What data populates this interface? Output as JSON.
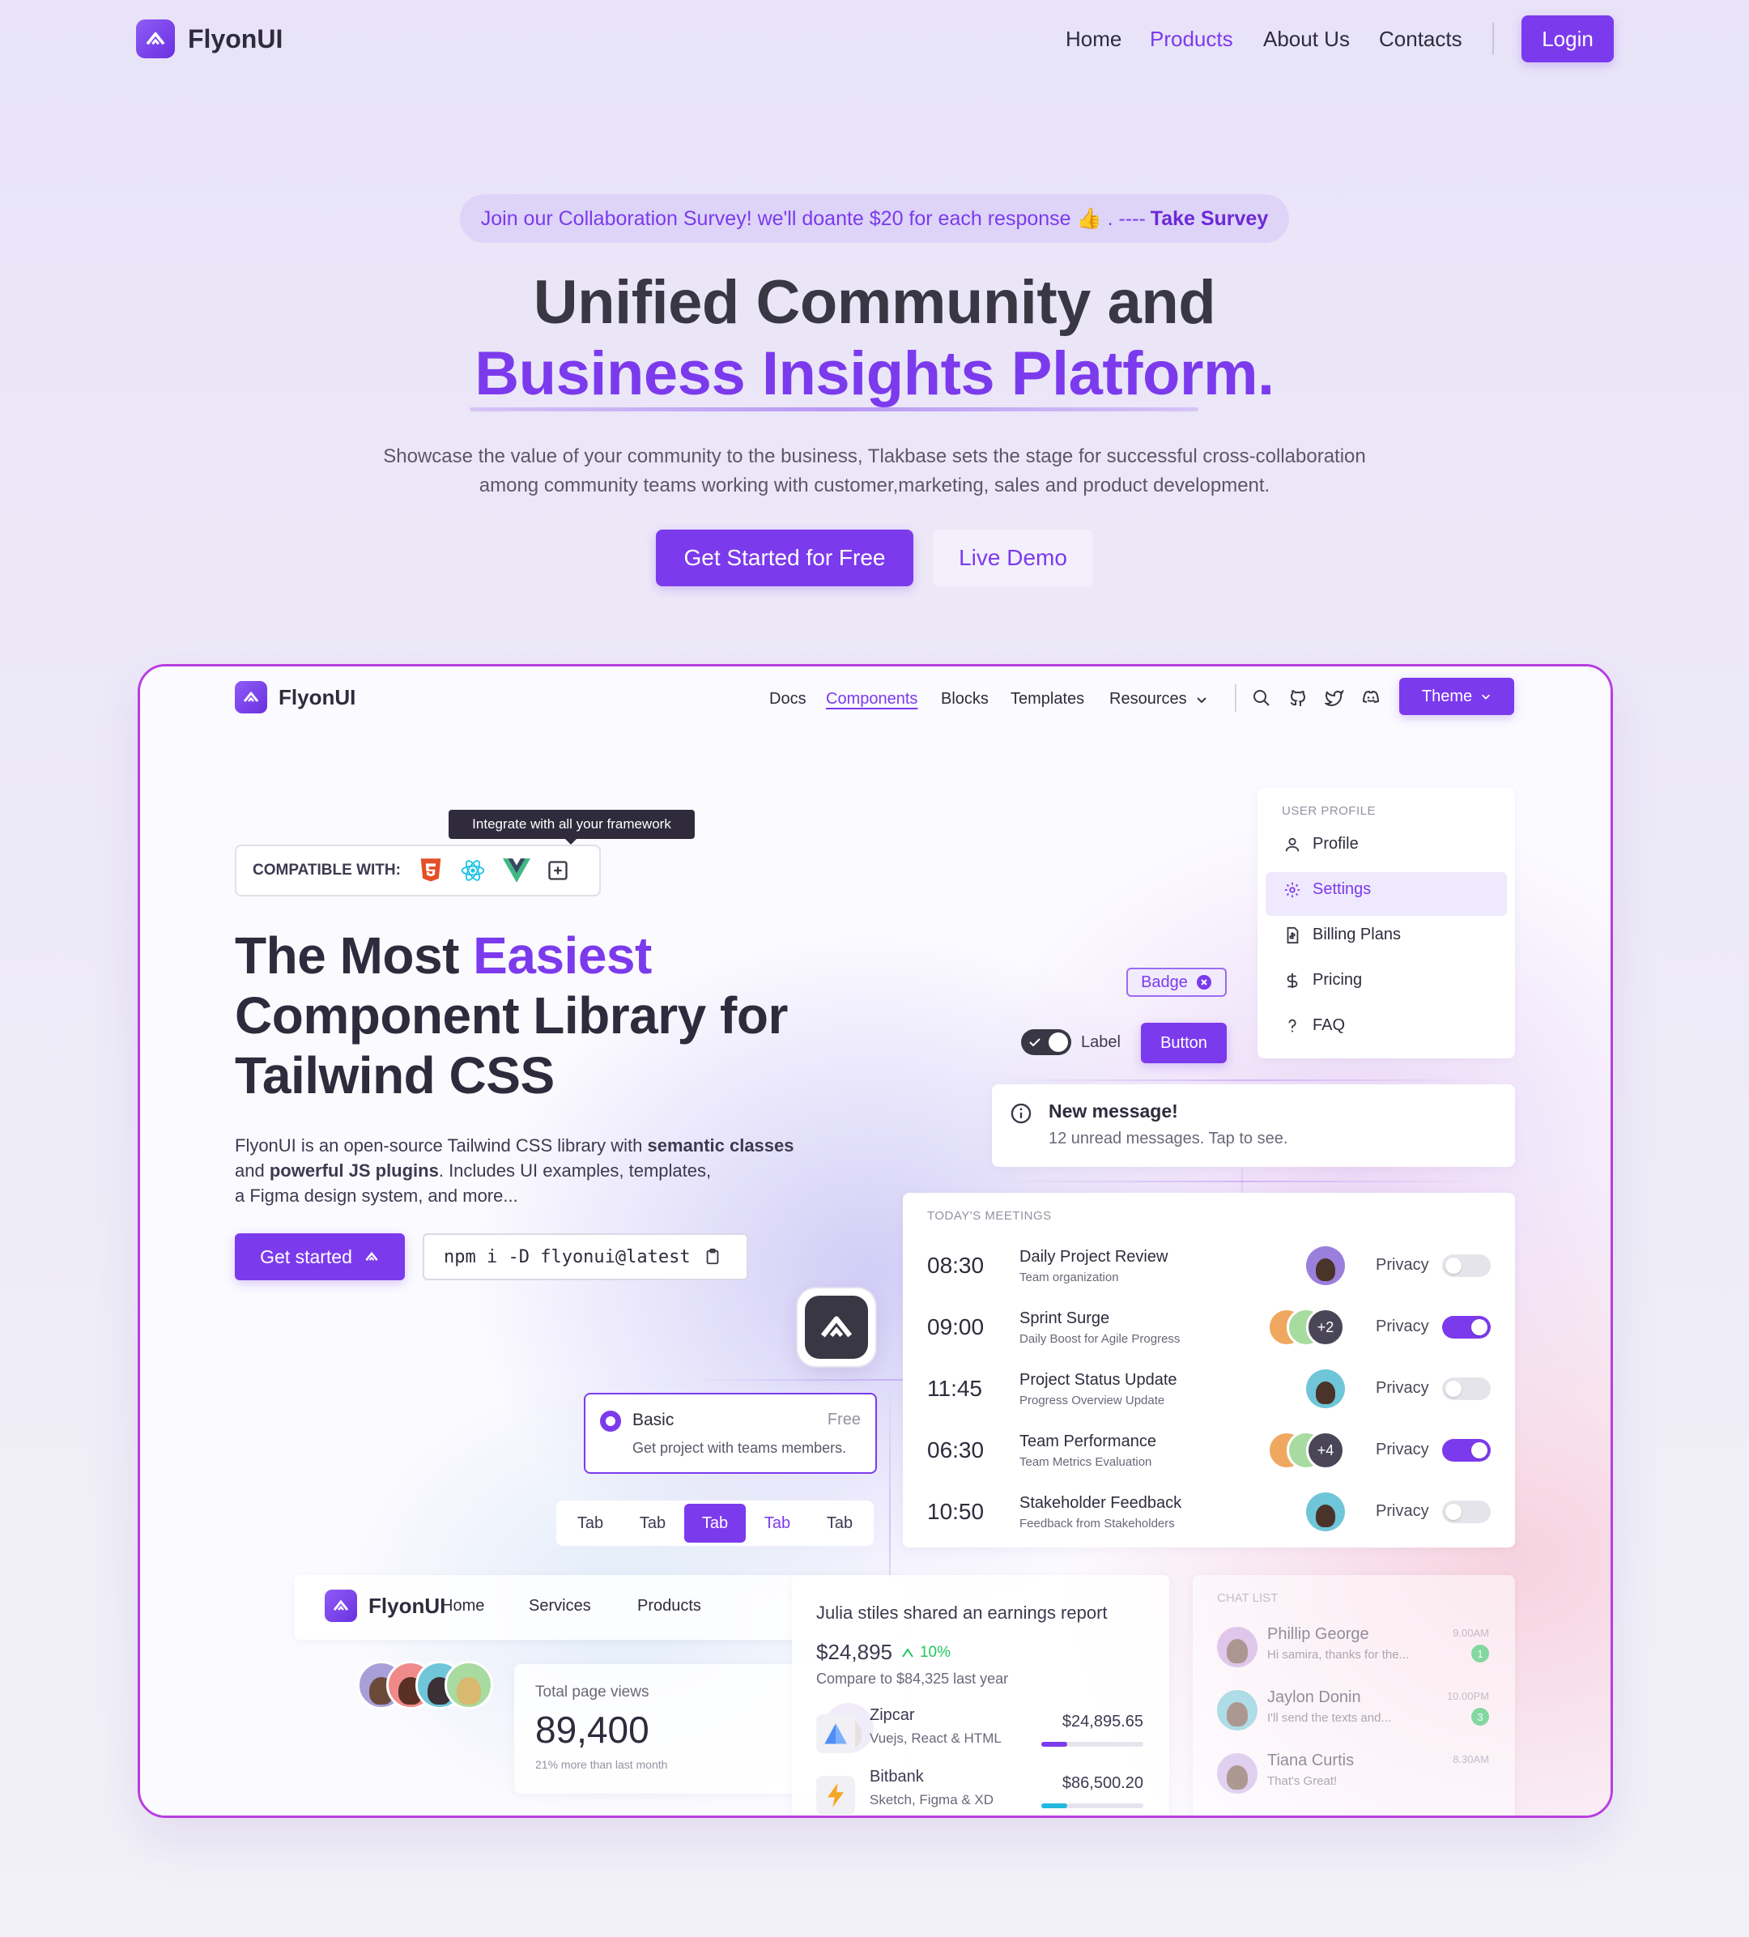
{
  "colors": {
    "accent": "#7c3aed",
    "frame_border": "#b83ee0",
    "success": "#22c55e"
  },
  "header": {
    "brand": "FlyonUI",
    "nav": [
      "Home",
      "Products",
      "About Us",
      "Contacts"
    ],
    "active_nav": "Products",
    "login": "Login"
  },
  "hero": {
    "survey_text": "Join our Collaboration Survey! we'll doante $20 for each response 👍 . ----",
    "survey_link": "Take Survey",
    "title_line1": "Unified Community and",
    "title_line2": "Business Insights Platform.",
    "description_line1": "Showcase the value of your community to the business, Tlakbase sets the stage for successful cross-collaboration",
    "description_line2": "among community teams working with customer,marketing, sales and product development.",
    "cta_primary": "Get Started for Free",
    "cta_secondary": "Live Demo"
  },
  "preview": {
    "brand": "FlyonUI",
    "nav": [
      "Docs",
      "Components",
      "Blocks",
      "Templates",
      "Resources"
    ],
    "active_nav": "Components",
    "theme_button": "Theme",
    "tooltip": "Integrate with all your framework",
    "compatible_label": "COMPATIBLE WITH:",
    "headline_part1": "The Most ",
    "headline_highlight": "Easiest",
    "headline_line2": "Component Library for",
    "headline_line3": "Tailwind CSS",
    "desc_a": "FlyonUI is an open-source Tailwind CSS library with ",
    "desc_b": "semantic classes",
    "desc_c": "and ",
    "desc_d": "powerful JS plugins",
    "desc_e": ". Includes UI examples, templates,",
    "desc_f": "a Figma design system, and more...",
    "get_started": "Get started",
    "npm_command": "npm i -D flyonui@latest",
    "badge": "Badge",
    "toggle_label": "Label",
    "button": "Button",
    "user_profile": {
      "heading": "USER PROFILE",
      "items": [
        {
          "label": "Profile",
          "icon": "user-icon"
        },
        {
          "label": "Settings",
          "icon": "gear-icon"
        },
        {
          "label": "Billing Plans",
          "icon": "invoice-icon"
        },
        {
          "label": "Pricing",
          "icon": "dollar-icon"
        },
        {
          "label": "FAQ",
          "icon": "question-icon"
        }
      ],
      "active": "Settings"
    },
    "alert": {
      "title": "New message!",
      "body": "12 unread messages. Tap to see."
    },
    "meetings": {
      "heading": "TODAY'S MEETINGS",
      "privacy_label": "Privacy",
      "rows": [
        {
          "time": "08:30",
          "title": "Daily Project Review",
          "sub": "Team organization",
          "extra": "",
          "privacy": false
        },
        {
          "time": "09:00",
          "title": "Sprint Surge",
          "sub": "Daily Boost for Agile Progress",
          "extra": "+2",
          "privacy": true
        },
        {
          "time": "11:45",
          "title": "Project Status Update",
          "sub": "Progress Overview Update",
          "extra": "",
          "privacy": false
        },
        {
          "time": "06:30",
          "title": "Team Performance",
          "sub": "Team Metrics Evaluation",
          "extra": "+4",
          "privacy": true
        },
        {
          "time": "10:50",
          "title": "Stakeholder Feedback",
          "sub": "Feedback from Stakeholders",
          "extra": "",
          "privacy": false
        }
      ]
    },
    "plan": {
      "name": "Basic",
      "price": "Free",
      "desc": "Get project with teams members."
    },
    "tabs": {
      "labels": [
        "Tab",
        "Tab",
        "Tab",
        "Tab",
        "Tab"
      ],
      "active_index": 2
    },
    "mini_nav": {
      "brand": "FlyonUI",
      "items": [
        "Home",
        "Services",
        "Products"
      ]
    },
    "page_views": {
      "label": "Total page views",
      "value": "89,400",
      "note": "21% more than last month"
    },
    "earnings": {
      "title": "Julia stiles shared an earnings report",
      "amount": "$24,895",
      "change": "10%",
      "compare": "Compare to $84,325 last year",
      "items": [
        {
          "name": "Zipcar",
          "sub": "Vuejs, React & HTML",
          "amount": "$24,895.65",
          "progress": 0.25,
          "color": "#7c3aed"
        },
        {
          "name": "Bitbank",
          "sub": "Sketch, Figma & XD",
          "amount": "$86,500.20",
          "progress": 0.25,
          "color": "#22b8e0"
        }
      ]
    },
    "chat": {
      "heading": "CHAT LIST",
      "items": [
        {
          "name": "Phillip George",
          "msg": "Hi samira, thanks for the...",
          "time": "9.00AM",
          "count": "1"
        },
        {
          "name": "Jaylon Donin",
          "msg": "I'll send the texts and...",
          "time": "10.00PM",
          "count": "3"
        },
        {
          "name": "Tiana Curtis",
          "msg": "That's Great!",
          "time": "8.30AM",
          "count": ""
        }
      ]
    }
  }
}
